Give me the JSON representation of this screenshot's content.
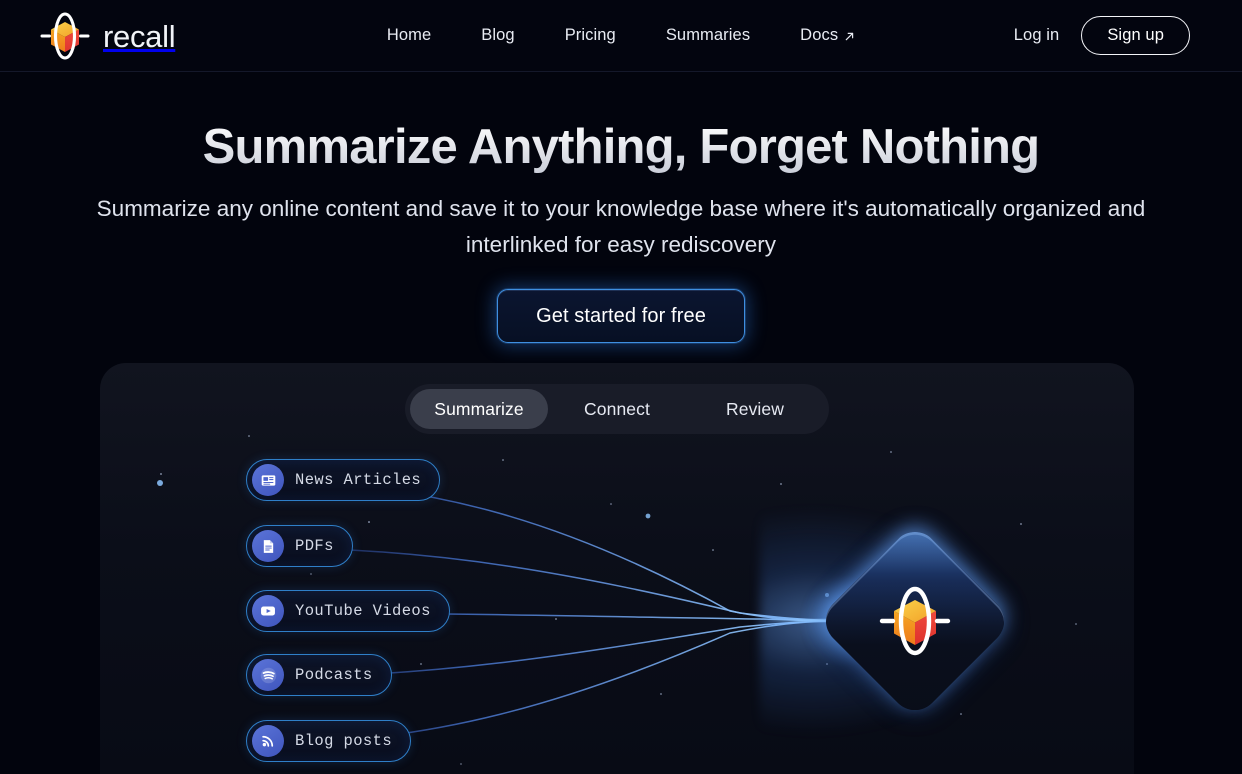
{
  "brand": {
    "name": "recall",
    "logo_icon": "recall-cube-orbit-logo"
  },
  "nav": {
    "items": [
      {
        "label": "Home",
        "icon": ""
      },
      {
        "label": "Blog",
        "icon": ""
      },
      {
        "label": "Pricing",
        "icon": ""
      },
      {
        "label": "Summaries",
        "icon": ""
      },
      {
        "label": "Docs",
        "icon": "external-link-icon"
      }
    ]
  },
  "auth": {
    "login_label": "Log in",
    "signup_label": "Sign up"
  },
  "hero": {
    "title": "Summarize Anything, Forget Nothing",
    "subtitle": "Summarize any online content and save it to your knowledge base where it's automatically organized and interlinked for easy rediscovery",
    "cta_label": "Get started for free"
  },
  "demo": {
    "tabs": [
      {
        "label": "Summarize",
        "active": true
      },
      {
        "label": "Connect",
        "active": false
      },
      {
        "label": "Review",
        "active": false
      }
    ],
    "sources": [
      {
        "label": "News Articles",
        "icon": "newspaper-icon"
      },
      {
        "label": "PDFs",
        "icon": "document-icon"
      },
      {
        "label": "YouTube Videos",
        "icon": "youtube-play-icon"
      },
      {
        "label": "Podcasts",
        "icon": "spotify-waves-icon"
      },
      {
        "label": "Blog posts",
        "icon": "rss-feed-icon"
      }
    ],
    "hub_icon": "recall-diamond-logo"
  },
  "colors": {
    "page_background": "#02040d",
    "header_background": "#03050f",
    "card_background": "#0e1220",
    "accent_blue": "#3f8fe0",
    "chip_border": "#2f7fc8",
    "chip_icon_blue": "#4f66cd",
    "tab_active": "#3a3e4b",
    "logo_orange": "#f5a623",
    "logo_red": "#e8413c",
    "logo_yellow": "#f7c52d",
    "text_primary": "#ffffff",
    "text_secondary": "#dfe3ed"
  }
}
